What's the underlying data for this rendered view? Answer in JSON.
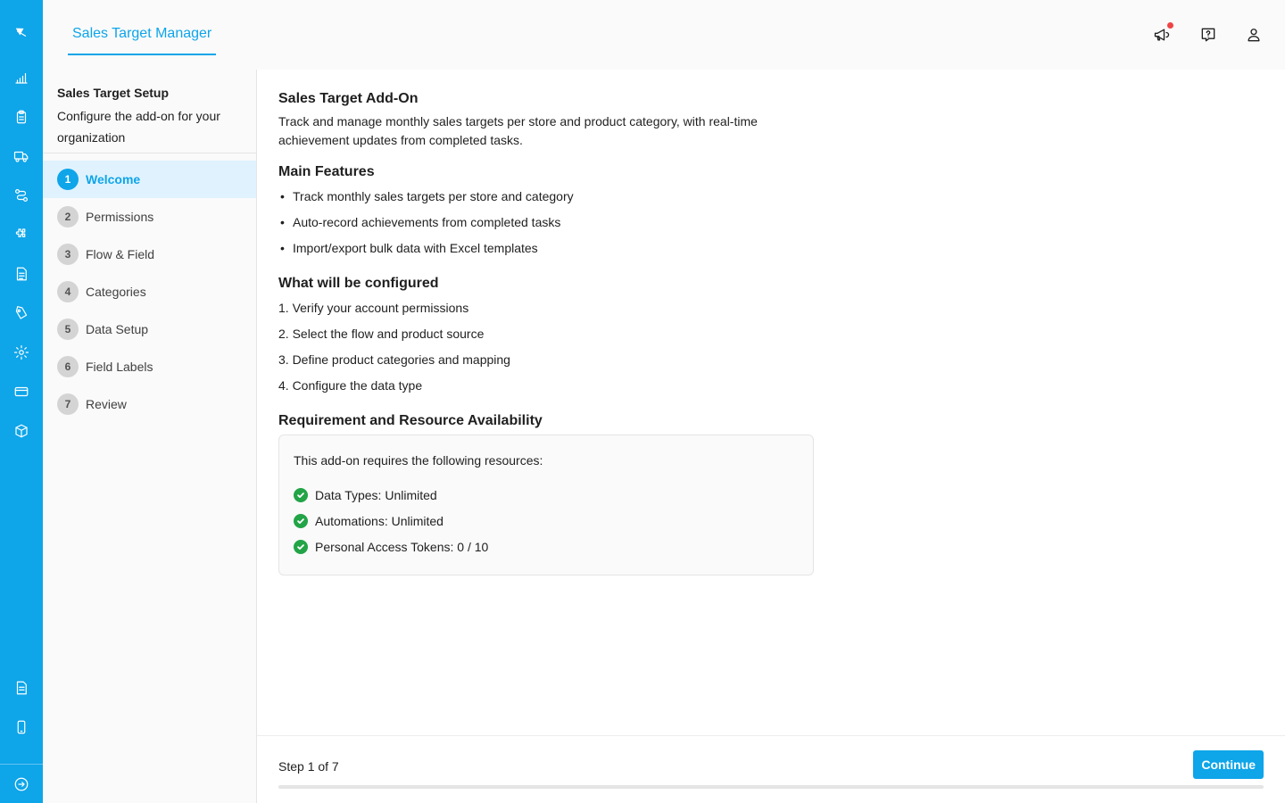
{
  "rail": {
    "top_icons": [
      "logo-icon",
      "chart-icon",
      "clipboard-icon",
      "truck-icon",
      "workflow-icon",
      "puzzle-icon",
      "document-icon",
      "tag-icon",
      "gear-icon",
      "credit-card-icon",
      "box-icon"
    ],
    "bottom_icons": [
      "notes-icon",
      "mobile-icon",
      "logout-icon"
    ]
  },
  "header": {
    "tab_label": "Sales Target Manager",
    "icons": [
      "megaphone-icon",
      "help-icon",
      "user-icon"
    ],
    "notification_color": "#ef4444"
  },
  "sidebar": {
    "title": "Sales Target Setup",
    "description": "Configure the add-on for your organization",
    "steps": [
      {
        "num": "1",
        "label": "Welcome",
        "active": true
      },
      {
        "num": "2",
        "label": "Permissions",
        "active": false
      },
      {
        "num": "3",
        "label": "Flow & Field",
        "active": false
      },
      {
        "num": "4",
        "label": "Categories",
        "active": false
      },
      {
        "num": "5",
        "label": "Data Setup",
        "active": false
      },
      {
        "num": "6",
        "label": "Field Labels",
        "active": false
      },
      {
        "num": "7",
        "label": "Review",
        "active": false
      }
    ]
  },
  "main": {
    "title": "Sales Target Add-On",
    "intro": "Track and manage monthly sales targets per store and product category, with real-time achievement updates from completed tasks.",
    "features_title": "Main Features",
    "features": [
      "Track monthly sales targets per store and category",
      "Auto-record achievements from completed tasks",
      "Import/export bulk data with Excel templates"
    ],
    "config_title": "What will be configured",
    "config_items": [
      "1. Verify your account permissions",
      "2. Select the flow and product source",
      "3. Define product categories and mapping",
      "4. Configure the data type"
    ],
    "req_title": "Requirement and Resource Availability",
    "req_intro": "This add-on requires the following resources:",
    "resources": [
      "Data Types: Unlimited",
      "Automations: Unlimited",
      "Personal Access Tokens: 0 / 10"
    ]
  },
  "footer": {
    "step_indicator": "Step 1 of 7",
    "continue_label": "Continue",
    "progress": 0
  },
  "colors": {
    "accent": "#0ea5e9",
    "success": "#22a447"
  }
}
